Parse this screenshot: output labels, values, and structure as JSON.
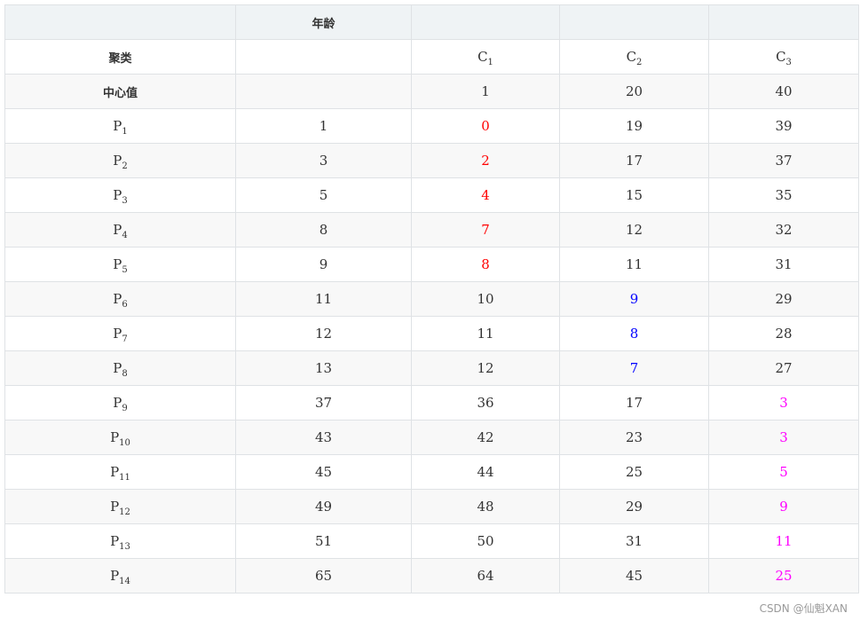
{
  "colors": {
    "red": "#ff0000",
    "blue": "#0000ff",
    "magenta": "#ff00ff",
    "text": "#333333",
    "border": "#dfe2e5",
    "header_bg": "#eff3f5",
    "stripe_bg": "#f8f8f8"
  },
  "header": [
    "",
    "年龄",
    "",
    "",
    ""
  ],
  "cluster_row": {
    "label": "聚类",
    "cells": [
      {
        "base": "",
        "sub": ""
      },
      {
        "base": "C",
        "sub": "1"
      },
      {
        "base": "C",
        "sub": "2"
      },
      {
        "base": "C",
        "sub": "3"
      }
    ]
  },
  "center_row": {
    "label": "中心值",
    "values": [
      "",
      "1",
      "20",
      "40"
    ]
  },
  "rows": [
    {
      "base": "P",
      "sub": "1",
      "age": "1",
      "c1": "0",
      "c2": "19",
      "c3": "39",
      "color": "red"
    },
    {
      "base": "P",
      "sub": "2",
      "age": "3",
      "c1": "2",
      "c2": "17",
      "c3": "37",
      "color": "red"
    },
    {
      "base": "P",
      "sub": "3",
      "age": "5",
      "c1": "4",
      "c2": "15",
      "c3": "35",
      "color": "red"
    },
    {
      "base": "P",
      "sub": "4",
      "age": "8",
      "c1": "7",
      "c2": "12",
      "c3": "32",
      "color": "red"
    },
    {
      "base": "P",
      "sub": "5",
      "age": "9",
      "c1": "8",
      "c2": "11",
      "c3": "31",
      "color": "red"
    },
    {
      "base": "P",
      "sub": "6",
      "age": "11",
      "c1": "10",
      "c2": "9",
      "c3": "29",
      "color": "blue"
    },
    {
      "base": "P",
      "sub": "7",
      "age": "12",
      "c1": "11",
      "c2": "8",
      "c3": "28",
      "color": "blue"
    },
    {
      "base": "P",
      "sub": "8",
      "age": "13",
      "c1": "12",
      "c2": "7",
      "c3": "27",
      "color": "blue"
    },
    {
      "base": "P",
      "sub": "9",
      "age": "37",
      "c1": "36",
      "c2": "17",
      "c3": "3",
      "color": "magenta"
    },
    {
      "base": "P",
      "sub": "10",
      "age": "43",
      "c1": "42",
      "c2": "23",
      "c3": "3",
      "color": "magenta"
    },
    {
      "base": "P",
      "sub": "11",
      "age": "45",
      "c1": "44",
      "c2": "25",
      "c3": "5",
      "color": "magenta"
    },
    {
      "base": "P",
      "sub": "12",
      "age": "49",
      "c1": "48",
      "c2": "29",
      "c3": "9",
      "color": "magenta"
    },
    {
      "base": "P",
      "sub": "13",
      "age": "51",
      "c1": "50",
      "c2": "31",
      "c3": "11",
      "color": "magenta"
    },
    {
      "base": "P",
      "sub": "14",
      "age": "65",
      "c1": "64",
      "c2": "45",
      "c3": "25",
      "color": "magenta"
    }
  ],
  "watermark": "CSDN @仙魁XAN"
}
